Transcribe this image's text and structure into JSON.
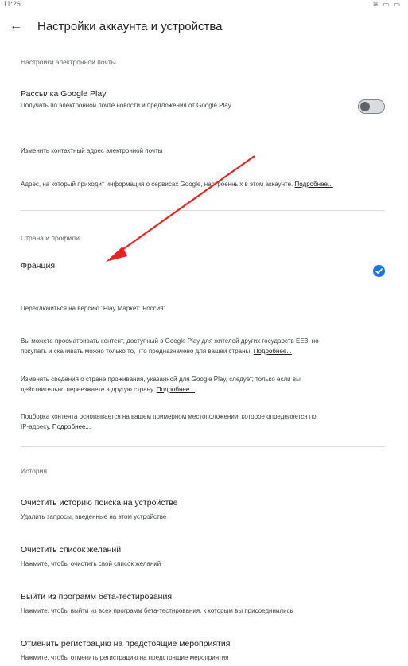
{
  "status": {
    "time": "11:26",
    "icons": "≋ ▭ ▭"
  },
  "header": {
    "title": "Настройки аккаунта и устройства"
  },
  "email": {
    "section": "Настройки электронной почты",
    "google_play_mailing": {
      "title": "Рассылка Google Play",
      "subtitle": "Получать по электронной почте новости и предложения от Google Play",
      "enabled": false
    },
    "change_address": "Изменить контактный адрес электронной почты",
    "address_info": "Адрес, на который приходит информация о сервисах Google, настроенных в этом аккаунте.",
    "more_link": "Подробнее..."
  },
  "country": {
    "section": "Страна и профили",
    "selected_country": "Франция",
    "switch_version": "Переключиться на версию \"Play Маркет: Россия\"",
    "info1_line1": "Вы можете просматривать контент, доступный в Google Play для жителей других государств ЕЕЗ, но",
    "info1_line2": "покупать и скачивать можно только то, что предназначено для вашей страны.",
    "info2_line1": "Изменять сведения о стране проживания, указанной для Google Play, следует, только если вы",
    "info2_line2": "действительно переезжаете в другую страну.",
    "info3_line1": "Подборка контента основывается на вашем примерном местоположении, которое определяется по",
    "info3_line2": "IP-адресу.",
    "more_link": "Подробнее..."
  },
  "history": {
    "section": "История",
    "clear_search": {
      "title": "Очистить историю поиска на устройстве",
      "subtitle": "Удалить запросы, введенные на этом устройстве"
    },
    "clear_wishlist": {
      "title": "Очистить список желаний",
      "subtitle": "Нажмите, чтобы очистить свой список желаний"
    },
    "leave_beta": {
      "title": "Выйти из программ бета-тестирования",
      "subtitle": "Нажмите, чтобы выйти из всех программ бета-тестирования, к которым вы присоединились"
    },
    "cancel_preregistration": {
      "title": "Отменить регистрацию на предстоящие мероприятия",
      "subtitle": "Нажмите, чтобы отменить регистрацию на предстоящие мероприятия"
    }
  },
  "colors": {
    "accent": "#1a73e8",
    "annotation": "#e8231f"
  }
}
